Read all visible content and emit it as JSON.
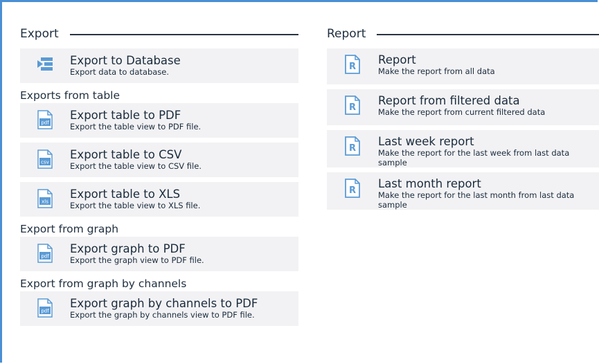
{
  "left": {
    "export_header": "Export",
    "export_items": [
      {
        "title": "Export to Database",
        "desc": "Export data to database.",
        "icon": "database-export-icon"
      }
    ],
    "table_header": "Exports from table",
    "table_items": [
      {
        "title": "Export table to PDF",
        "desc": "Export the table view to PDF file.",
        "icon": "pdf-file-icon",
        "badge": "pdf"
      },
      {
        "title": "Export table to CSV",
        "desc": "Export the table view to CSV file.",
        "icon": "csv-file-icon",
        "badge": "csv"
      },
      {
        "title": "Export table to XLS",
        "desc": "Export the table view to XLS file.",
        "icon": "xls-file-icon",
        "badge": "xls"
      }
    ],
    "graph_header": "Export from graph",
    "graph_items": [
      {
        "title": "Export graph to PDF",
        "desc": "Export the graph view to PDF file.",
        "icon": "pdf-file-icon",
        "badge": "pdf"
      }
    ],
    "channels_header": "Export from graph by channels",
    "channels_items": [
      {
        "title": "Export graph by channels to PDF",
        "desc": "Export the graph by channels view to PDF file.",
        "icon": "pdf-file-icon",
        "badge": "pdf"
      }
    ]
  },
  "right": {
    "report_header": "Report",
    "report_items": [
      {
        "title": "Report",
        "desc": "Make the report from all data",
        "icon": "report-icon",
        "badge": "R"
      },
      {
        "title": "Report from filtered data",
        "desc": "Make the report from current filtered data",
        "icon": "report-icon",
        "badge": "R"
      },
      {
        "title": "Last week report",
        "desc": "Make the report for the last week from last data sample",
        "icon": "report-icon",
        "badge": "R"
      },
      {
        "title": "Last month report",
        "desc": "Make the report for the last month from last data sample",
        "icon": "report-icon",
        "badge": "R"
      }
    ]
  },
  "colors": {
    "accent": "#4a8fd4",
    "icon": "#5b9bd5",
    "item_bg": "#f2f2f4"
  }
}
